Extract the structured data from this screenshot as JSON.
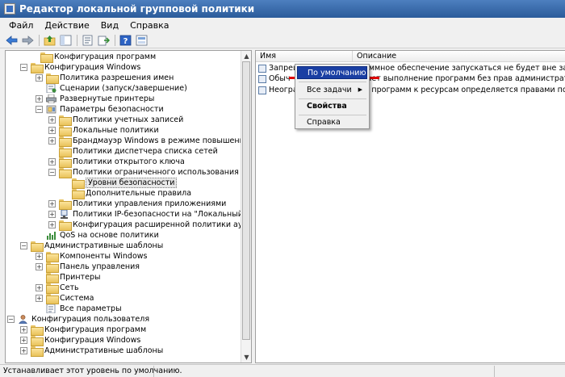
{
  "window": {
    "title": "Редактор локальной групповой политики"
  },
  "menu": [
    "Файл",
    "Действие",
    "Вид",
    "Справка"
  ],
  "toolbar": [
    "back-icon",
    "forward-icon",
    "up-folder-icon",
    "show-tree-icon",
    "properties-icon",
    "export-icon",
    "help-icon",
    "console-icon"
  ],
  "tree": [
    {
      "label": "Конфигурация программ",
      "expander": "",
      "icon": "folder"
    },
    {
      "label": "Конфигурация Windows",
      "expander": "−",
      "icon": "folder"
    },
    {
      "label": "Политика разрешения имен",
      "expander": "+",
      "icon": "folder"
    },
    {
      "label": "Сценарии (запуск/завершение)",
      "expander": "",
      "icon": "script"
    },
    {
      "label": "Развернутые принтеры",
      "expander": "+",
      "icon": "printer"
    },
    {
      "label": "Параметры безопасности",
      "expander": "−",
      "icon": "security"
    },
    {
      "label": "Политики учетных записей",
      "expander": "+",
      "icon": "folder"
    },
    {
      "label": "Локальные политики",
      "expander": "+",
      "icon": "folder"
    },
    {
      "label": "Брандмауэр Windows в режиме повышенной безопа",
      "expander": "+",
      "icon": "folder"
    },
    {
      "label": "Политики диспетчера списка сетей",
      "expander": "",
      "icon": "folder"
    },
    {
      "label": "Политики открытого ключа",
      "expander": "+",
      "icon": "folder"
    },
    {
      "label": "Политики ограниченного использования программ",
      "expander": "−",
      "icon": "folder"
    },
    {
      "label": "Уровни безопасности",
      "expander": "",
      "icon": "folder",
      "selected": true
    },
    {
      "label": "Дополнительные правила",
      "expander": "",
      "icon": "folder"
    },
    {
      "label": "Политики управления приложениями",
      "expander": "+",
      "icon": "folder"
    },
    {
      "label": "Политики IP-безопасности на \"Локальный компьют",
      "expander": "+",
      "icon": "ipsec"
    },
    {
      "label": "Конфигурация расширенной политики аудита",
      "expander": "+",
      "icon": "folder"
    },
    {
      "label": "QoS на основе политики",
      "expander": "",
      "icon": "chart"
    },
    {
      "label": "Административные шаблоны",
      "expander": "−",
      "icon": "folder"
    },
    {
      "label": "Компоненты Windows",
      "expander": "+",
      "icon": "folder"
    },
    {
      "label": "Панель управления",
      "expander": "+",
      "icon": "folder"
    },
    {
      "label": "Принтеры",
      "expander": "",
      "icon": "folder"
    },
    {
      "label": "Сеть",
      "expander": "+",
      "icon": "folder"
    },
    {
      "label": "Система",
      "expander": "+",
      "icon": "folder"
    },
    {
      "label": "Все параметры",
      "expander": "",
      "icon": "settings"
    },
    {
      "label": "Конфигурация пользователя",
      "expander": "−",
      "icon": "user"
    },
    {
      "label": "Конфигурация программ",
      "expander": "+",
      "icon": "folder"
    },
    {
      "label": "Конфигурация Windows",
      "expander": "+",
      "icon": "folder"
    },
    {
      "label": "Административные шаблоны",
      "expander": "+",
      "icon": "folder"
    }
  ],
  "list": {
    "col_name": "Имя",
    "col_desc": "Описание",
    "rows": [
      {
        "name": "Запрещ",
        "desc": "граммное обеспечение запускаться не будет вне зависимо"
      },
      {
        "name": "Обыч",
        "desc": "ешает выполнение программ без прав администратора, но"
      },
      {
        "name": "Неогра",
        "desc": "туп программ к ресурсам определяется правами пользовате"
      }
    ]
  },
  "context_menu": {
    "items": [
      {
        "label": "По умолчанию",
        "highlighted": true
      },
      {
        "label": "Все задачи",
        "submenu": true
      },
      {
        "label": "Свойства",
        "bold": true
      },
      {
        "label": "Справка"
      }
    ]
  },
  "status": {
    "text": "Устанавливает этот уровень по умолчанию."
  },
  "colors": {
    "title_bar": "#2b5b9a",
    "highlight": "#1a3fa3",
    "red_underline": "#e00000"
  }
}
